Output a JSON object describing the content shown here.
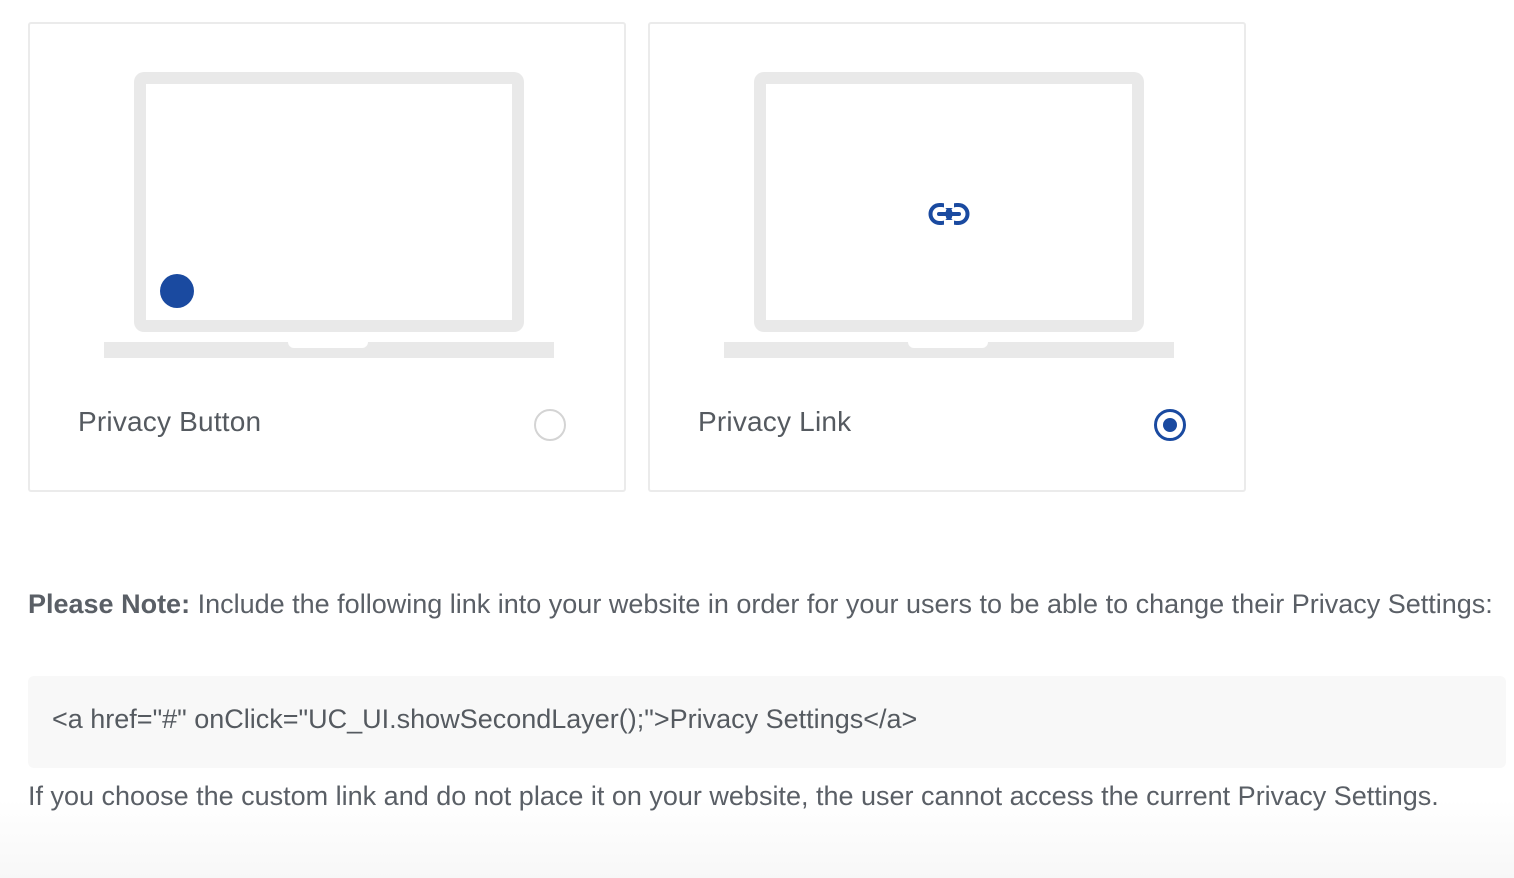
{
  "options": [
    {
      "label": "Privacy Button",
      "selected": false,
      "icon": "privacy-button-dot-icon"
    },
    {
      "label": "Privacy Link",
      "selected": true,
      "icon": "link-icon"
    }
  ],
  "note": {
    "strong": "Please Note:",
    "text": " Include the following link into your website in order for your users to be able to change their Privacy Settings:"
  },
  "code": "<a href=\"#\" onClick=\"UC_UI.showSecondLayer();\">Privacy Settings</a>",
  "footer": "If you choose the custom link and do not place it on your website, the user cannot access the current Privacy Settings.",
  "colors": {
    "accent": "#1a4aa0",
    "border": "#ebebeb",
    "laptop": "#e9e9e9",
    "text": "#555a60",
    "code_background": "#f8f8f8"
  }
}
